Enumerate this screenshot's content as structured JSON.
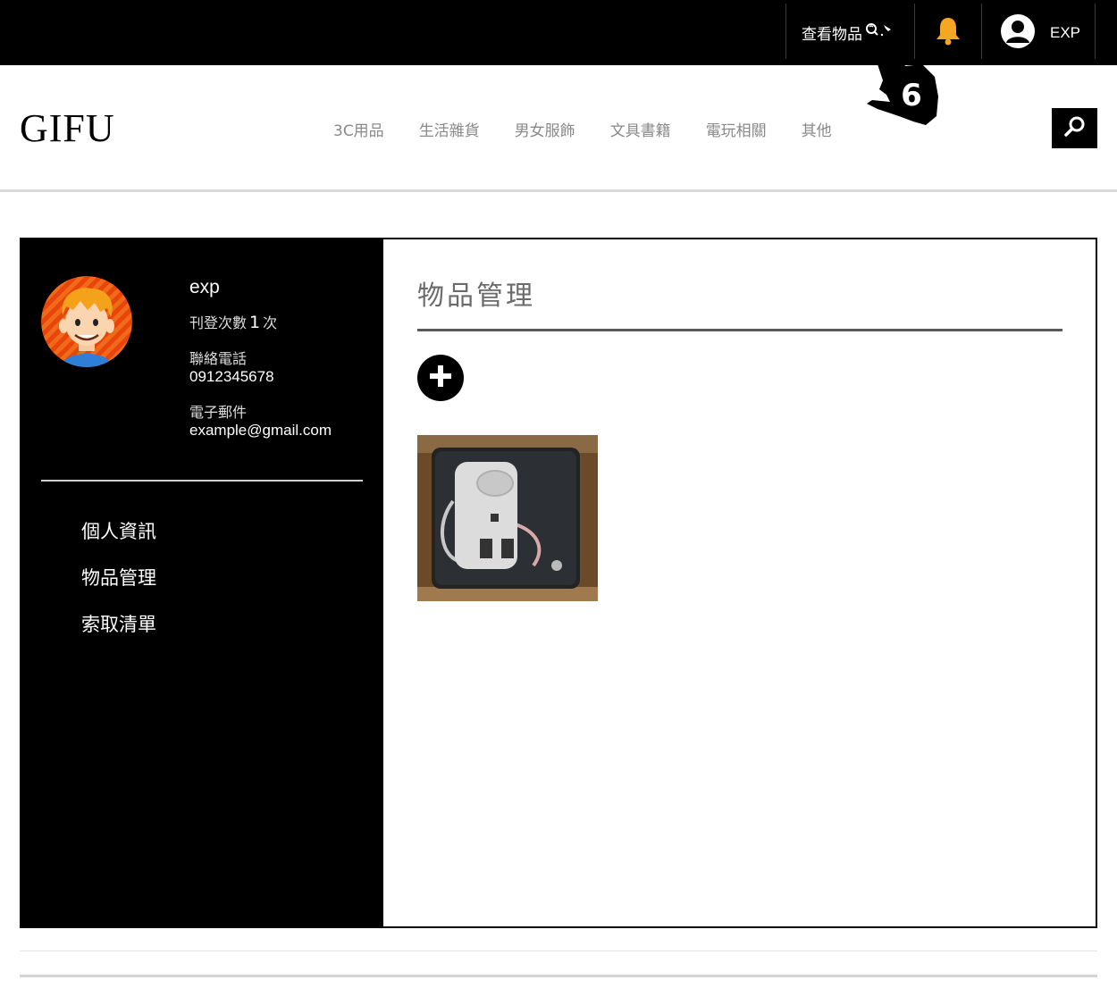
{
  "topbar": {
    "view_items_label": "查看物品",
    "user_name": "EXP",
    "colors": {
      "background": "#000000",
      "bell": "#f5a623"
    }
  },
  "annotation": {
    "step_number": "6"
  },
  "header": {
    "logo": "GIFU",
    "nav": [
      "3C用品",
      "生活雜貨",
      "男女服飾",
      "文具書籍",
      "電玩相關",
      "其他"
    ]
  },
  "profile": {
    "username": "exp",
    "post_count_prefix": "刊登次數",
    "post_count": "1",
    "post_count_suffix": "次",
    "phone_label": "聯絡電話",
    "phone": "0912345678",
    "email_label": "電子郵件",
    "email": "example@gmail.com"
  },
  "side_menu": [
    "個人資訊",
    "物品管理",
    "索取清單"
  ],
  "content": {
    "title": "物品管理",
    "items": [
      {
        "image": "power-bank-photo"
      }
    ]
  }
}
